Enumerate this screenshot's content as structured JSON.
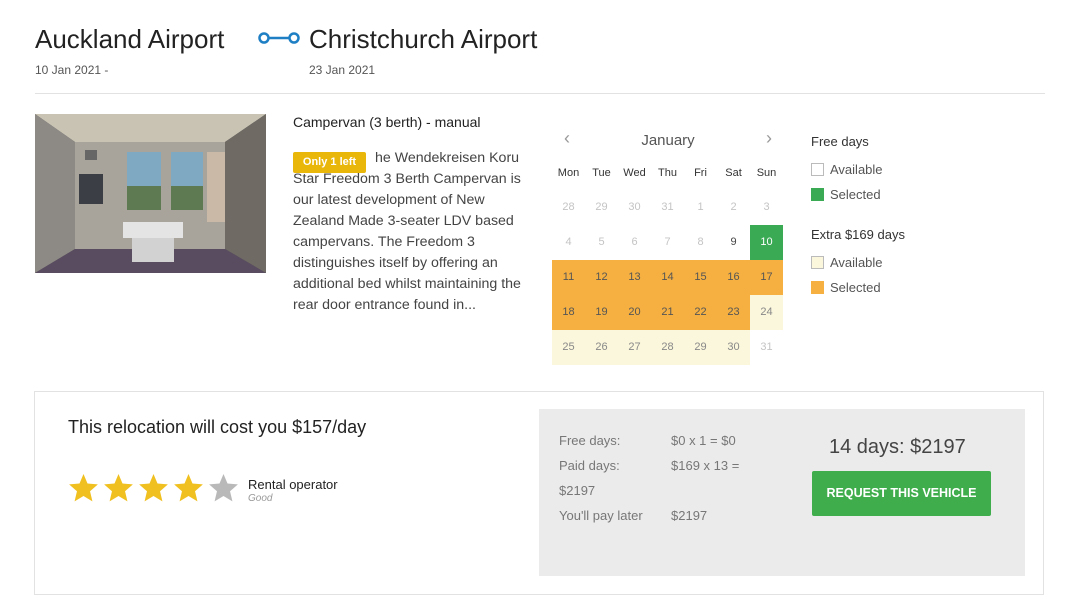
{
  "route": {
    "from": {
      "name": "Auckland Airport",
      "date": "10 Jan 2021 -"
    },
    "to": {
      "name": "Christchurch Airport",
      "date": "23 Jan 2021"
    },
    "icon": "route-connector-icon",
    "accent_color": "#1f7fc4"
  },
  "vehicle": {
    "title": "Campervan (3 berth) - manual",
    "badge": "Only 1 left",
    "badge_color": "#e9b60a",
    "description": "he Wendekreisen Koru Star Freedom 3 Berth Campervan is our latest development of New Zealand Made 3-seater LDV based campervans. The Freedom 3 distinguishes itself by offering an additional bed whilst maintaining the rear door entrance found in..."
  },
  "calendar": {
    "month": "January",
    "prev_icon": "chevron-left-icon",
    "next_icon": "chevron-right-icon",
    "weekdays": [
      "Mon",
      "Tue",
      "Wed",
      "Thu",
      "Fri",
      "Sat",
      "Sun"
    ],
    "weeks": [
      [
        {
          "d": "28",
          "s": "muted"
        },
        {
          "d": "29",
          "s": "muted"
        },
        {
          "d": "30",
          "s": "muted"
        },
        {
          "d": "31",
          "s": "muted"
        },
        {
          "d": "1",
          "s": "muted"
        },
        {
          "d": "2",
          "s": "muted"
        },
        {
          "d": "3",
          "s": "muted"
        }
      ],
      [
        {
          "d": "4",
          "s": "muted"
        },
        {
          "d": "5",
          "s": "muted"
        },
        {
          "d": "6",
          "s": "muted"
        },
        {
          "d": "7",
          "s": "muted"
        },
        {
          "d": "8",
          "s": "muted"
        },
        {
          "d": "9",
          "s": "normal"
        },
        {
          "d": "10",
          "s": "free-selected"
        }
      ],
      [
        {
          "d": "11",
          "s": "extra-selected"
        },
        {
          "d": "12",
          "s": "extra-selected"
        },
        {
          "d": "13",
          "s": "extra-selected"
        },
        {
          "d": "14",
          "s": "extra-selected"
        },
        {
          "d": "15",
          "s": "extra-selected"
        },
        {
          "d": "16",
          "s": "extra-selected"
        },
        {
          "d": "17",
          "s": "extra-selected"
        }
      ],
      [
        {
          "d": "18",
          "s": "extra-selected"
        },
        {
          "d": "19",
          "s": "extra-selected"
        },
        {
          "d": "20",
          "s": "extra-selected"
        },
        {
          "d": "21",
          "s": "extra-selected"
        },
        {
          "d": "22",
          "s": "extra-selected"
        },
        {
          "d": "23",
          "s": "extra-selected"
        },
        {
          "d": "24",
          "s": "extra-available"
        }
      ],
      [
        {
          "d": "25",
          "s": "extra-available"
        },
        {
          "d": "26",
          "s": "extra-available"
        },
        {
          "d": "27",
          "s": "extra-available"
        },
        {
          "d": "28",
          "s": "extra-available"
        },
        {
          "d": "29",
          "s": "extra-available"
        },
        {
          "d": "30",
          "s": "extra-available"
        },
        {
          "d": "31",
          "s": "muted"
        }
      ]
    ]
  },
  "legend": {
    "free": {
      "title": "Free days",
      "available": "Available",
      "selected": "Selected",
      "selected_color": "#3aaa55"
    },
    "extra": {
      "title": "Extra $169 days",
      "available": "Available",
      "selected": "Selected",
      "selected_color": "#f5b041"
    }
  },
  "cost": {
    "title": "This relocation will cost you $157/day",
    "rating": {
      "stars": 4,
      "max": 5,
      "label": "Rental operator",
      "text": "Good",
      "star_color": "#f0c020",
      "empty_color": "#b9b9b9"
    },
    "breakdown": {
      "free_label": "Free days:",
      "free_value": "$0 x 1 = $0",
      "paid_label": "Paid days:",
      "paid_value": "$169 x 13 =",
      "paid_total": "$2197",
      "later_label": "You'll pay later",
      "later_value": "$2197"
    },
    "total": "14 days: $2197",
    "request_button": "REQUEST THIS VEHICLE",
    "button_color": "#3fad4c"
  }
}
